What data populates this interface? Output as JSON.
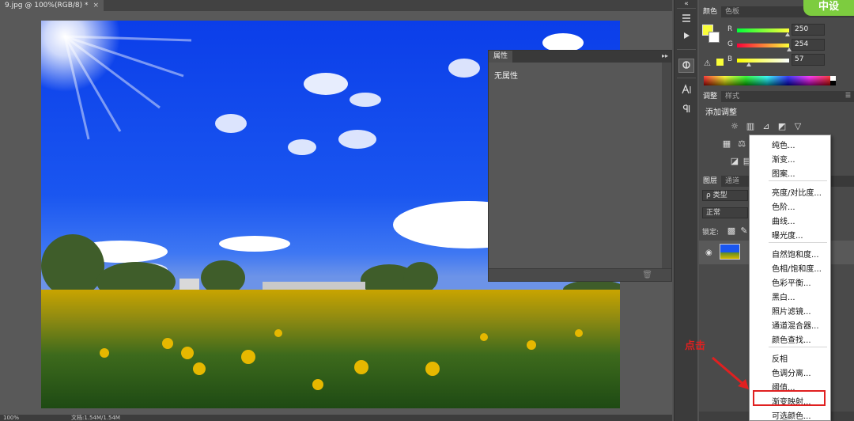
{
  "document": {
    "tab_title": "9.jpg @ 100%(RGB/8) *",
    "close_glyph": "×"
  },
  "status": {
    "zoom": "100%",
    "doc_info": "文档:1.54M/1.54M"
  },
  "properties_panel": {
    "tab": "属性",
    "content": "无属性",
    "collapse": "▸▸",
    "menu": "▾☰",
    "trash_icon": "🗑"
  },
  "tool_strip": {
    "collapse": "«"
  },
  "color_panel": {
    "tabs": [
      "颜色",
      "色板"
    ],
    "channels": [
      {
        "label": "R",
        "value": "250"
      },
      {
        "label": "G",
        "value": "254"
      },
      {
        "label": "B",
        "value": "57"
      }
    ],
    "foreground": "#fafe39",
    "background": "#ffffff"
  },
  "adjust_panel": {
    "tabs": [
      "调整",
      "样式"
    ],
    "title": "添加调整"
  },
  "layers_panel": {
    "tabs": [
      "图层",
      "通道"
    ],
    "filter": "ρ 类型",
    "blend": "正常",
    "lock": "锁定:"
  },
  "badge": {
    "text": "中设"
  },
  "annotation": {
    "text": "点击"
  },
  "menu": {
    "group1": [
      "纯色...",
      "渐变...",
      "图案..."
    ],
    "group2": [
      "亮度/对比度...",
      "色阶...",
      "曲线...",
      "曝光度..."
    ],
    "group3": [
      "自然饱和度...",
      "色相/饱和度...",
      "色彩平衡...",
      "黑白...",
      "照片滤镜...",
      "通道混合器...",
      "颜色查找..."
    ],
    "group4": [
      "反相",
      "色调分离...",
      "阈值...",
      "渐变映射...",
      "可选颜色..."
    ],
    "highlighted": "渐变映射..."
  }
}
